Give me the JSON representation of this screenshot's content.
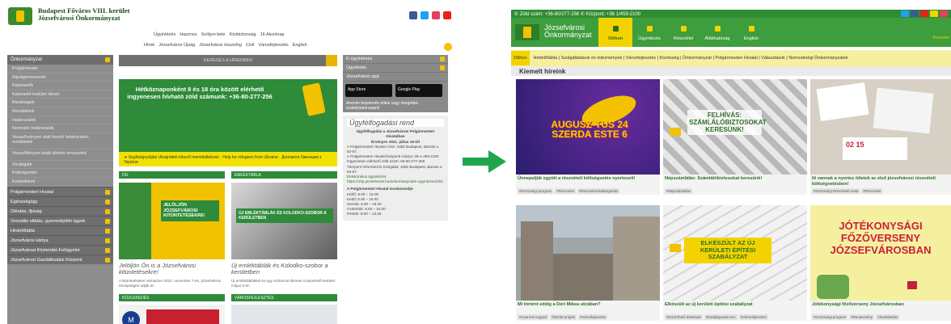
{
  "old_site": {
    "logo_line1": "Budapest Főváros VIII. kerület",
    "logo_line2": "Józsefvárosi Önkormányzat",
    "social_colors": [
      "#3b5998",
      "#1da1f2",
      "#e4405f",
      "#e62117"
    ],
    "topnav1": [
      "Ügyintézés",
      "Hasznos",
      "Szóljon bele",
      "Közbiztonság",
      "16 Akciónap"
    ],
    "topnav2": [
      "Hírek",
      "Józsefváros Újság",
      "Józsefváros összefog",
      "Civil",
      "Városfejlesztés",
      "English"
    ],
    "sidebar": {
      "header": "Önkormányzat",
      "items": [
        "Polgármester",
        "Alpolgármesterek",
        "Képviselők",
        "Képviselő-testület ülései",
        "Bizottságok",
        "Rendeletek",
        "Határozatok",
        "Normatív határozatok",
        "Vesszővelnyert alatt hozott határozatok, rendeletek",
        "Vesszőfelnyert alatti döntés tervezetek",
        "Stratégiák",
        "Költségvetés",
        "Közérdekek"
      ],
      "groups": [
        "Polgármesteri Hivatal",
        "Egészségügy",
        "Oktatás, ifjúság",
        "Szociális ellátás, gyermekjóléti ügyek",
        "Hirdetőtábla",
        "Józsefváros kártya",
        "Józsefvárosi Közterület-Felügyelet",
        "Józsefvárosi Gazdálkodási Központ"
      ]
    },
    "search_label": "KERESÉS A HÍREKBEN",
    "banner_text": "Hétköznaponként 8 és 18 óra között elérhető ingyenesen hívható zöld számunk: +36-80-277-256",
    "yellow_band": "➜ Segítségnyújtás Ukrajnából érkező menekülteknek · Help for refugees from Ukraine · Допомога біженцям з України",
    "cards": [
      {
        "head": "DÍJ",
        "title": "Jelöljön Ön is a Józsefvárosi kitüntetésekre!",
        "img_label": "JELÖLJÖN JÓZSEFVÁROSI KITÜNTETÉSEKRE!",
        "text": "A kitüntetéseket várhatóan 2022. november 7-én, józsefvárosi ünnepségen adják át."
      },
      {
        "head": "EMLÉKTÁBLA",
        "title": "Új emléktáblák és Kolodko-szobor a kerületben",
        "img_label": "ÚJ EMLÉKTÁBLÁK ÉS KOLODKO-SZOBOR A KERÜLETBEN",
        "text": "Új emléktáblákkal és egy szoborral dönnek a képviselő-testület május 5-én"
      }
    ],
    "section_heads": [
      "KÖZLEKEDÉS",
      "VÁROSFEJLESZTÉS"
    ],
    "right_items": [
      "E-ügyintézés",
      "Ügyeletek"
    ],
    "app_label": "Józsefváros app",
    "app_buttons": [
      "App Store",
      "Google Play"
    ],
    "anon_text": "Anonim bejelentés etikai vagy integritási szabálytalanságról",
    "hours": {
      "title": "Ügyfélfogadási rend",
      "subtitle": "Ügyfélfogadás a Józsefvárosi Polgármesteri Hivatalban",
      "date": "Érvényes 2021. július 15-től",
      "lines": [
        "A Polgármesteri Hivatal címe: 1082 Budapest, Baross u. 63-67.",
        "A Polgármesteri Hivatal központi száma: 06-1-459-2100",
        "Ingyenesen elérhető zöld szám: 06-80-277-256",
        "Támpont Információs Szolgálat: 1082 Budapest, Baross u. 63-67.",
        "Elektronikus ügyintézés: https://ohp.jozsefvaros.hu/onkormanyzat/e-ugyintezes/253",
        "A Polgármesteri Hivatal munkarendje:",
        "Hétfő: 8.00 – 18.00",
        "Kedd: 8.00 – 16.00",
        "Szerda: 8.00 – 16.30",
        "Csütörtök: 8.00 – 16.00",
        "Péntek: 8.00 – 13.30"
      ]
    }
  },
  "new_site": {
    "contact": "✆ Zöld szám: +36-80/277-256  ✆ Központ: +36 1/459-2100",
    "social_colors": [
      "#1da1f2",
      "#3b5998",
      "#e62117",
      "#f2d300",
      "#e4405f"
    ],
    "logo_line1": "Józsefvárosi",
    "logo_line2": "Önkormányzat",
    "nav": [
      "Otthon",
      "Ügyintézés",
      "Részvétel",
      "Átláthatóság",
      "English"
    ],
    "search_label": "Keresés",
    "breadcrumb": [
      "Otthon",
      "Hirdetőtábla",
      "Szolgáltatások és intézmények",
      "Városfejlesztés",
      "Közösség",
      "Önkormányzat",
      "Polgármesteri Hivatal",
      "Választások",
      "Nemzetiségi Önkormányzatok"
    ],
    "featured": "Kiemelt híreink",
    "tiles": [
      {
        "title": "Ünnepeljük együtt a részvételi költségvetés nyerteseit!",
        "tags": [
          "#Közösségi program",
          "#Részvétel",
          "#Részvételi költségvetés"
        ],
        "img_text": "AUGUSZ-TUS 24 SZERDA ESTE 6",
        "bg": "#2a1e6e"
      },
      {
        "title": "Népszámlálás: Számlálóbiztosokat keresünk!",
        "tags": [
          "#Népszámlálás"
        ],
        "img_text": "FELHÍVÁS: SZÁMLÁLÓBIZTOSOKAT KERESÜNK!",
        "bg": "#c9c9c9"
      },
      {
        "title": "Itt vannak a nyertes ötletek az első józsefvárosi részvételi költségvetésben!",
        "tags": [
          "#Közösségi Részvételi Iroda",
          "#Részvétel"
        ],
        "img_text": "02 15",
        "bg": "#d7d0c4"
      },
      {
        "title": "Mi történt eddig a Déri Miksa utcában?",
        "tags": [
          "#Csarnok negyed",
          "#DériM projekt",
          "#Városfejlesztés"
        ],
        "img_text": "",
        "bg": "#9fa6a8"
      },
      {
        "title": "Elkészült az új kerületi építési szabályzat",
        "tags": [
          "#Közérthető döntések",
          "#Szabályozási terv",
          "#Városfejlesztés"
        ],
        "img_text": "ELKÉSZÜLT AZ ÚJ KERÜLETI ÉPÍTÉSI SZABÁLYZAT",
        "bg": "#e3e3e3"
      },
      {
        "title": "Jótékonysági főzőverseny Józsefvárosban",
        "tags": [
          "#Közösségi program",
          "#Rendezvény",
          "#Szolidaritás"
        ],
        "img_text": "JÓTÉKONYSÁGI FŐZŐVERSENY JÓZSEFVÁROSBAN",
        "bg": "#f4f0a0"
      }
    ]
  }
}
